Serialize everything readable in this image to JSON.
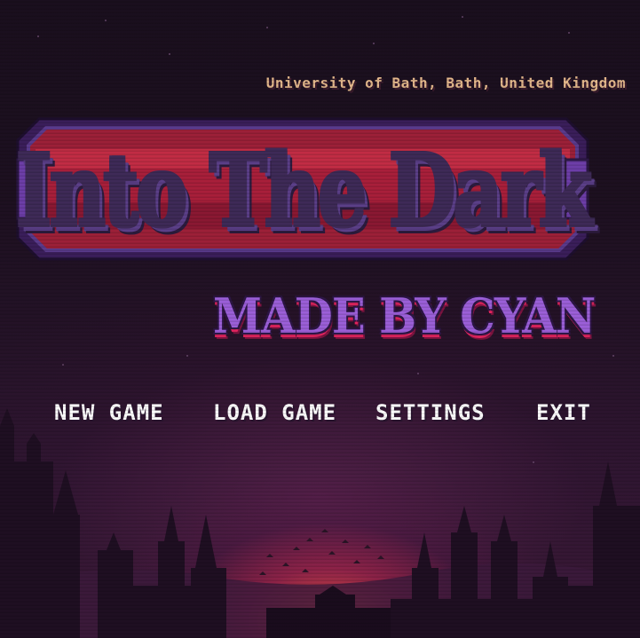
{
  "header": {
    "location": "University of Bath, Bath, United Kingdom"
  },
  "logo": {
    "title": "Into The Dark",
    "subtitle": "MADE BY CYAN"
  },
  "menu": {
    "items": [
      {
        "label": "NEW GAME"
      },
      {
        "label": "LOAD GAME"
      },
      {
        "label": "SETTINGS"
      },
      {
        "label": "EXIT"
      }
    ]
  },
  "colors": {
    "title_fill": "#f4b24a",
    "title_outline": "#3e2a57",
    "subtitle_fill": "#9b5fd8",
    "subtitle_drip": "#e0245e",
    "menu_text": "#ffffff",
    "location_text": "#e4b88c",
    "sun_glow": "#ff5a46"
  }
}
